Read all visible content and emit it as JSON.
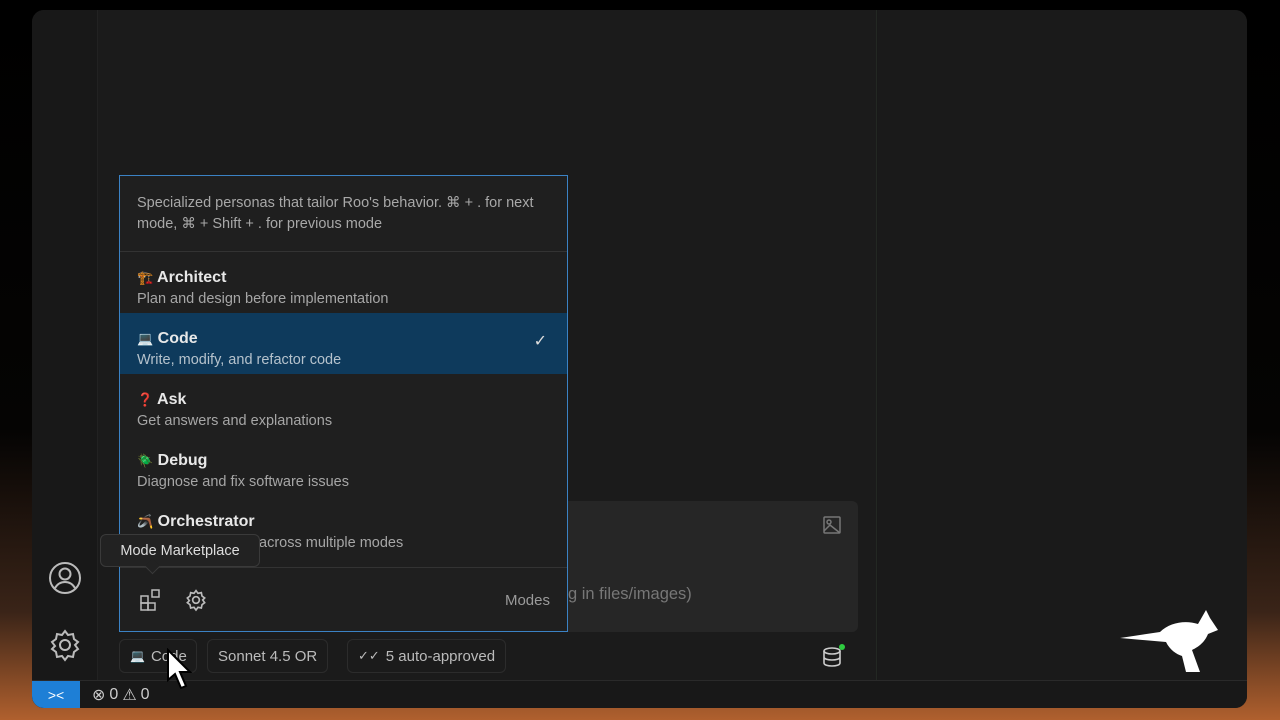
{
  "mode_popup": {
    "description": "Specialized personas that tailor Roo's behavior. ⌘ + . for next mode, ⌘ + Shift + . for previous mode",
    "modes": [
      {
        "icon": "🏗️",
        "name": "Architect",
        "description": "Plan and design before implementation",
        "selected": false
      },
      {
        "icon": "💻",
        "name": "Code",
        "description": "Write, modify, and refactor code",
        "selected": true
      },
      {
        "icon": "❓",
        "name": "Ask",
        "description": "Get answers and explanations",
        "selected": false
      },
      {
        "icon": "🪲",
        "name": "Debug",
        "description": "Diagnose and fix software issues",
        "selected": false
      },
      {
        "icon": "🪃",
        "name": "Orchestrator",
        "description": "across multiple modes",
        "selected": false
      }
    ],
    "footer_label": "Modes",
    "tooltip": "Mode Marketplace"
  },
  "input": {
    "placeholder_visible": "g in files/images)"
  },
  "bottom_bar": {
    "mode_label": "Code",
    "mode_icon": "💻",
    "model": "Sonnet 4.5 OR",
    "auto_approved": "5 auto-approved"
  },
  "status_bar": {
    "errors": "0",
    "warnings": "0"
  },
  "colors": {
    "accent": "#3b82c4",
    "selected": "#0e3a5c",
    "remote": "#1e7fd6"
  }
}
